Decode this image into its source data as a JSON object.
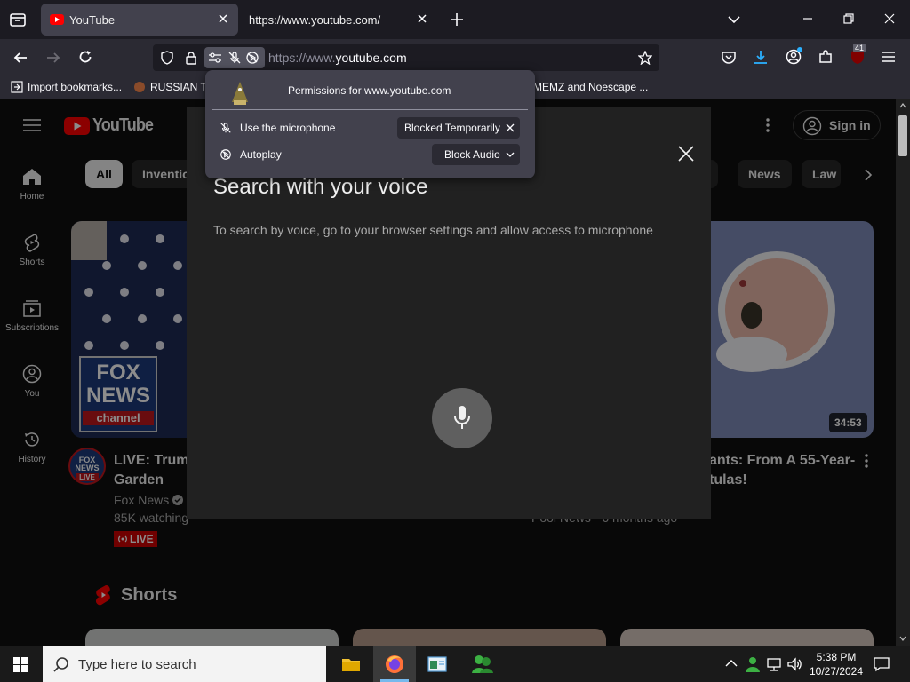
{
  "browser": {
    "tabs": [
      {
        "title": "YouTube",
        "active": true
      },
      {
        "title": "https://www.youtube.com/",
        "active": false
      }
    ],
    "url": {
      "prefix": "https://www.",
      "domain": "youtube.com"
    },
    "badge_count": "41",
    "bookmarks": [
      "Import bookmarks...",
      "RUSSIAN TE",
      "MEMZ and Noescape ..."
    ]
  },
  "permissions_popup": {
    "title": "Permissions for www.youtube.com",
    "rows": [
      {
        "label": "Use the microphone",
        "action": "Blocked Temporarily"
      },
      {
        "label": "Autoplay",
        "action": "Block Audio"
      }
    ]
  },
  "youtube": {
    "logo_text": "YouTube",
    "sign_in": "Sign in",
    "sidebar": [
      {
        "label": "Home"
      },
      {
        "label": "Shorts"
      },
      {
        "label": "Subscriptions"
      },
      {
        "label": "You"
      },
      {
        "label": "History"
      }
    ],
    "chips": [
      "All",
      "Inventio",
      "y",
      "News",
      "Law"
    ],
    "videos": [
      {
        "title_line1": "LIVE: Trump",
        "title_line2": "Garden",
        "channel": "Fox News",
        "views": "85K watching",
        "badge": "LIVE",
        "thumb_logo_l1": "FOX",
        "thumb_logo_l2": "NEWS",
        "thumb_logo_l3": "channel",
        "avatar_l1": "FOX",
        "avatar_l2": "NEWS",
        "avatar_badge": "LIVE"
      },
      {
        "title_line1": "ants: From A 55-Year-",
        "title_line2": "tulas!",
        "meta": "Pool News · 6 months ago",
        "duration": "34:53"
      }
    ],
    "shorts_heading": "Shorts"
  },
  "voice_dialog": {
    "title": "Search with your voice",
    "message": "To search by voice, go to your browser settings and allow access to microphone"
  },
  "taskbar": {
    "search_placeholder": "Type here to search",
    "time": "5:38 PM",
    "date": "10/27/2024"
  }
}
